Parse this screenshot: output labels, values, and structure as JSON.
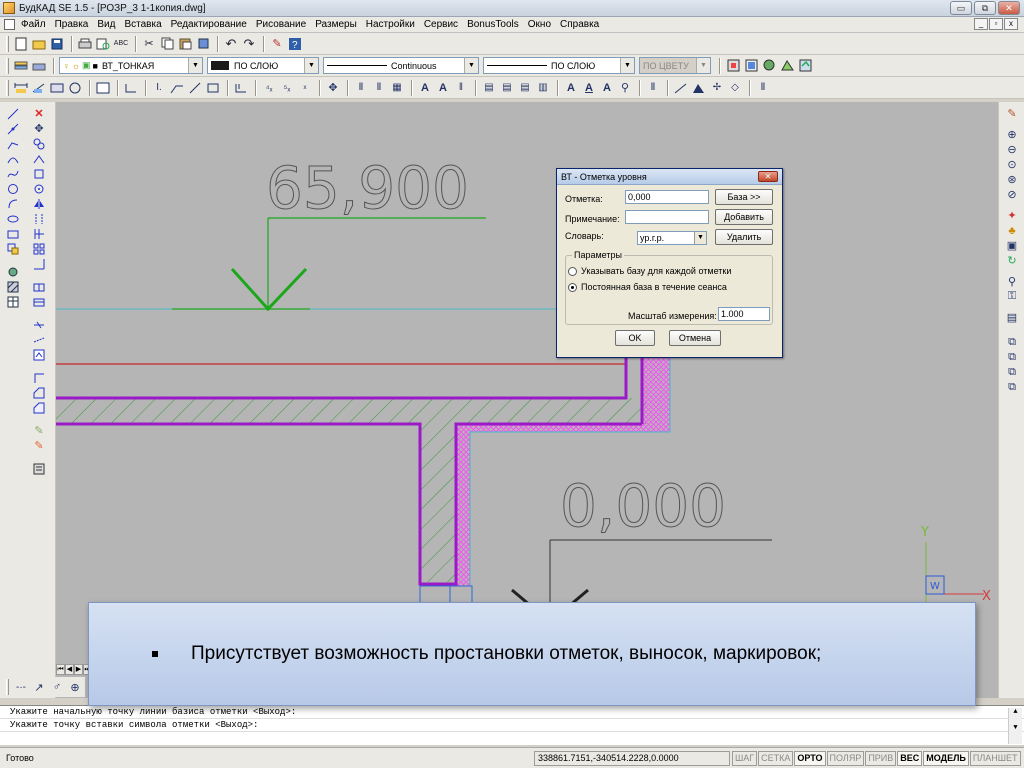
{
  "window": {
    "title": "БудКАД SE 1.5 - [РОЗР_3 1-1копия.dwg]",
    "buttons": [
      "▭",
      "⧉",
      "✕"
    ]
  },
  "menu": {
    "items": [
      "Файл",
      "Правка",
      "Вид",
      "Вставка",
      "Редактирование",
      "Рисование",
      "Размеры",
      "Настройки",
      "Сервис",
      "BonusTools",
      "Окно",
      "Справка"
    ],
    "mdi_buttons": [
      "_",
      "▫",
      "x"
    ]
  },
  "properties_bar": {
    "layer": "ВТ_ТОНКАЯ",
    "color": "ПО СЛОЮ",
    "linetype": "Continuous",
    "lineweight": "ПО СЛОЮ",
    "plotstyle": "ПО ЦВЕТУ"
  },
  "drawing": {
    "level_top": "65,900",
    "level_bottom": "0,000",
    "ucs_y": "Y",
    "ucs_x": "X",
    "ucs_w": "W"
  },
  "dialog": {
    "title": "ВТ - Отметка уровня",
    "close": "✕",
    "elevation_label": "Отметка:",
    "elevation_value": "0,000",
    "base_button": "База >>",
    "note_label": "Примечание:",
    "note_value": "",
    "add_button": "Добавить",
    "dictionary_label": "Словарь:",
    "dictionary_value": "ур.г.р.",
    "delete_button": "Удалить",
    "params_title": "Параметры",
    "radio_each": "Указывать базу для каждой отметки",
    "radio_const": "Постоянная база в течение сеанса",
    "scale_label": "Масштаб измерения:",
    "scale_value": "1.000",
    "ok_button": "OK",
    "cancel_button": "Отмена"
  },
  "command": {
    "line1": "Укажите начальную точку линии базиса отметки <Выход>:",
    "line2": "Укажите точку вставки символа отметки <Выход>:"
  },
  "status": {
    "text": "Готово",
    "coords": "338861.7151,-340514.2228,0.0000",
    "toggles": [
      {
        "label": "ШАГ",
        "on": false
      },
      {
        "label": "СЕТКА",
        "on": false
      },
      {
        "label": "ОРТО",
        "on": true
      },
      {
        "label": "ПОЛЯР",
        "on": false
      },
      {
        "label": "ПРИВ",
        "on": false
      },
      {
        "label": "ВЕС",
        "on": true
      },
      {
        "label": "МОДЕЛЬ",
        "on": true
      },
      {
        "label": "ПЛАНШЕТ",
        "on": false
      }
    ]
  },
  "overlay": {
    "bullet": "▪",
    "text": "Присутствует возможность простановки отметок, выносок, маркировок;"
  }
}
